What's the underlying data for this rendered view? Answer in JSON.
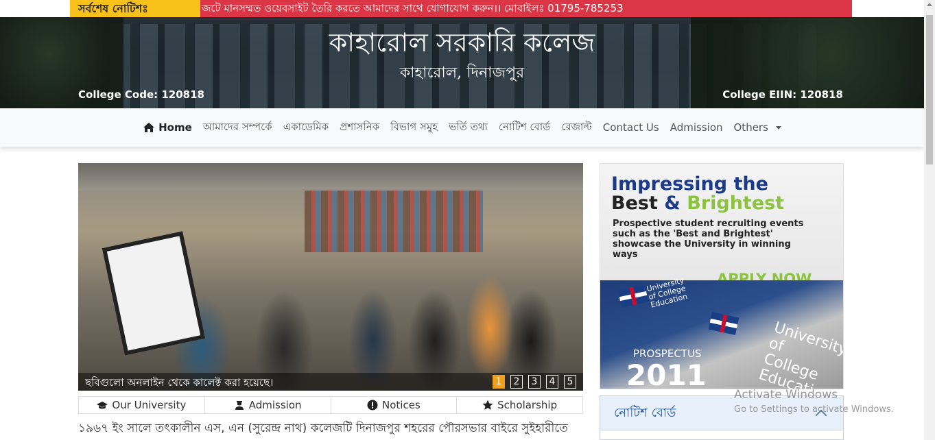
{
  "notice": {
    "label": "সর্বশেষ নোটিশঃ",
    "text": "জটে মানসম্মত ওয়েবসাইট তৈরি করতে আমাদের সাথে যোগাযোগ করুন।। মোবাইলঃ 01795-785253"
  },
  "header": {
    "title": "কাহারোল সরকারি কলেজ",
    "subtitle": "কাহারোল, দিনাজপুর",
    "college_code": "College Code: 120818",
    "college_eiin": "College EIIN: 120818"
  },
  "nav": {
    "items": [
      {
        "label": "Home",
        "icon": "home-icon"
      },
      {
        "label": "আমাদের সম্পর্কে"
      },
      {
        "label": "একাডেমিক"
      },
      {
        "label": "প্রশাসনিক"
      },
      {
        "label": "বিভাগ সমুহ"
      },
      {
        "label": "ভর্তি তথ্য"
      },
      {
        "label": "নোটিশ বোর্ড"
      },
      {
        "label": "রেজাল্ট"
      },
      {
        "label": "Contact Us"
      },
      {
        "label": "Admission"
      },
      {
        "label": "Others"
      }
    ]
  },
  "slider": {
    "caption": "ছবিগুলো অনলাইন থেকে কালেক্ট করা হয়েছে।",
    "pages": [
      "1",
      "2",
      "3",
      "4",
      "5"
    ],
    "active_page": "1",
    "accent_color": "#f0a020"
  },
  "ad": {
    "line1": "Impressing the",
    "line2_best": "Best",
    "line2_amp": "&",
    "line2_brightest": "Brightest",
    "body": "Prospective student recruiting events such as the 'Best and Brightest' showcase the University in winning ways",
    "cta": "APPLY NOW",
    "book_uni_small": "University of College Education",
    "book_uni_large": "University of College Education",
    "prospectus": "PROSPECTUS",
    "year": "2011"
  },
  "tabs": [
    {
      "label": "Our University",
      "icon": "graduation-cap-icon"
    },
    {
      "label": "Admission",
      "icon": "user-graduate-icon"
    },
    {
      "label": "Notices",
      "icon": "exclamation-circle-icon"
    },
    {
      "label": "Scholarship",
      "icon": "star-icon"
    }
  ],
  "about_text": "১৯৬৭ ইং সালে তৎকালীন এস, এন (সুরেন্দ্র নাথ) কলেজটি দিনাজপুর শহরের পৌরসভার বাইরে সুইহারীতে",
  "notice_board": {
    "title": "নোটিশ বোর্ড"
  },
  "watermark": {
    "line1": "Activate Windows",
    "line2": "Go to Settings to activate Windows."
  },
  "colors": {
    "notice_label_bg": "#f8c11c",
    "notice_text_bg": "#dc3545",
    "notice_board_title": "#1f5aa8"
  }
}
